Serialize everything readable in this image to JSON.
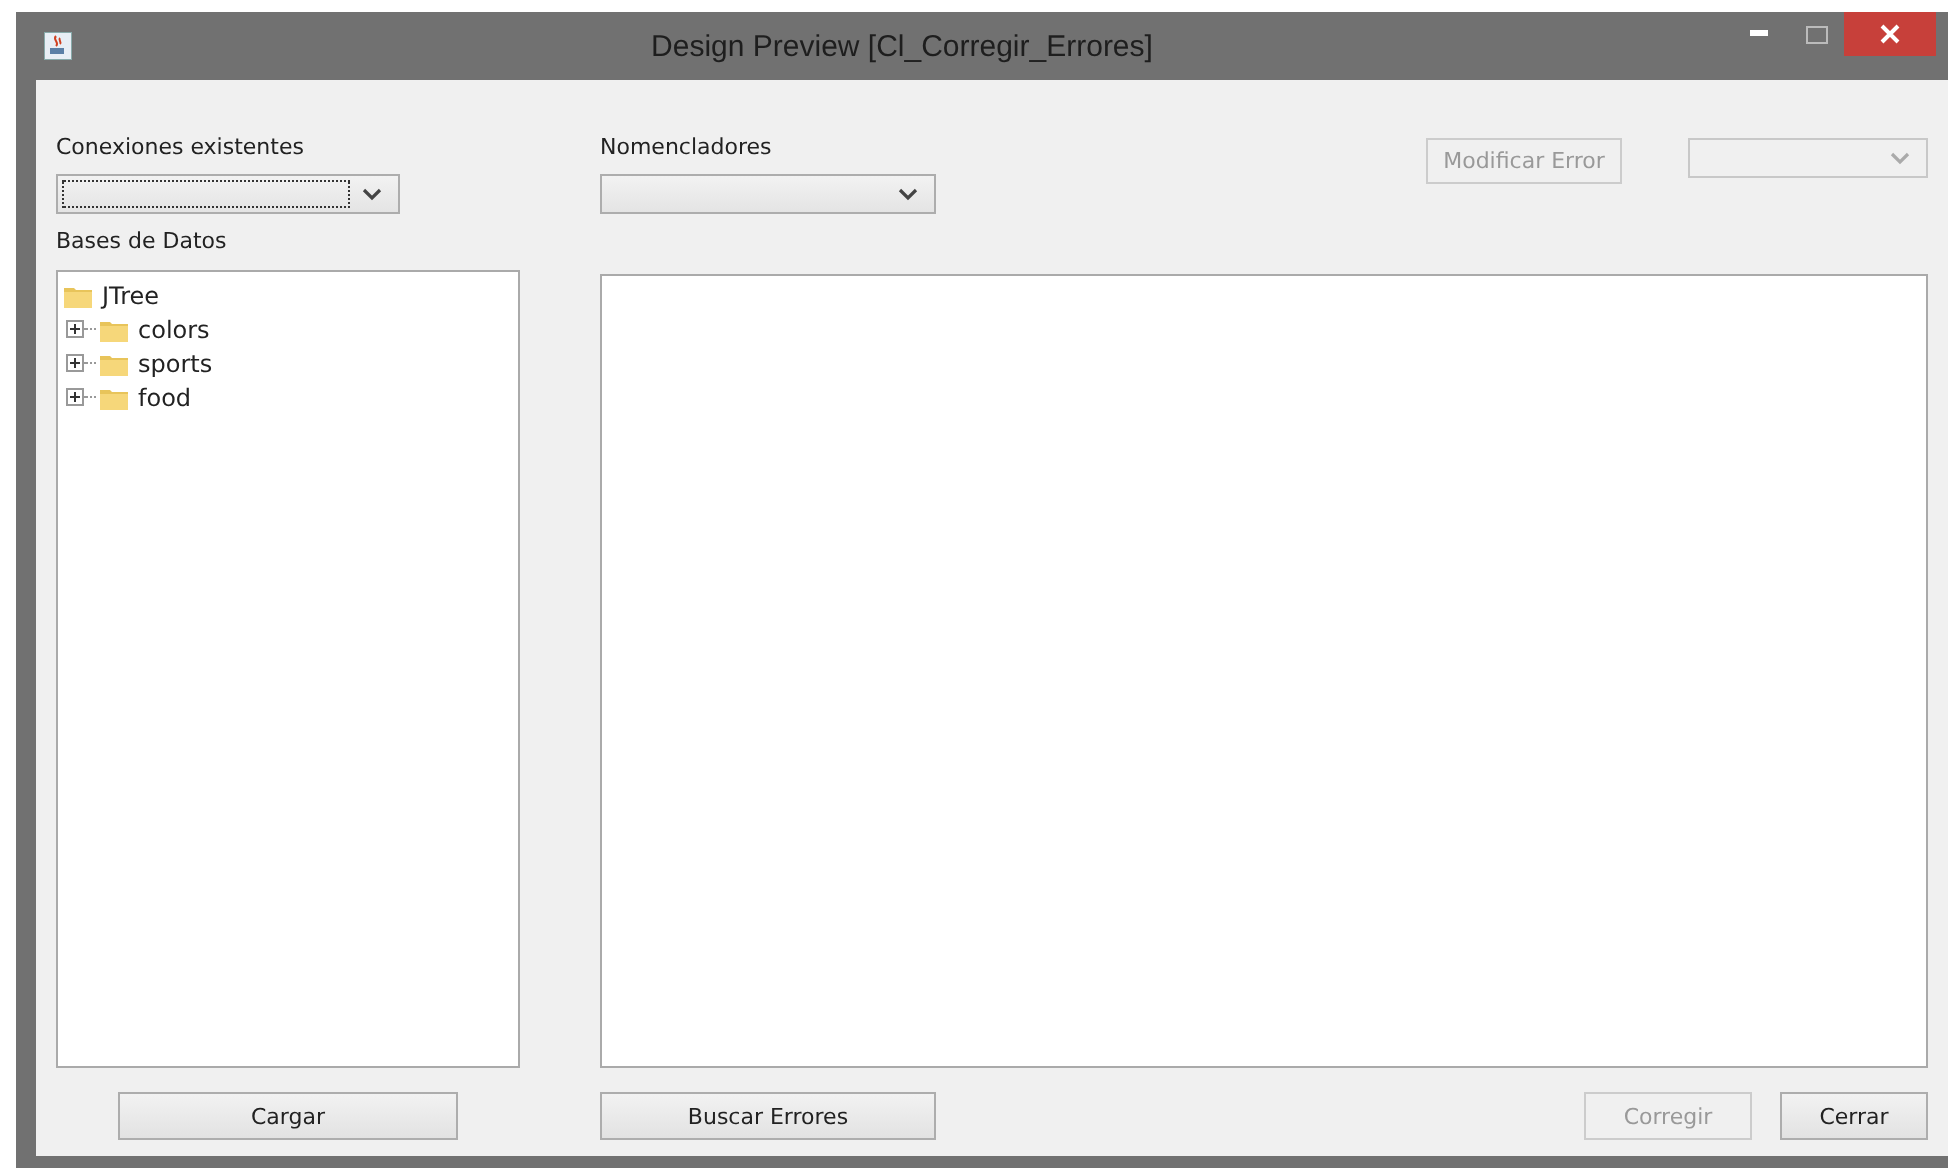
{
  "window": {
    "title": "Design Preview [Cl_Corregir_Errores]"
  },
  "left": {
    "connections_label": "Conexiones existentes",
    "connections_combo": {
      "disabled": false,
      "focused": true
    },
    "databases_label": "Bases de Datos",
    "tree": [
      {
        "label": "JTree",
        "expanded": true,
        "children": [
          {
            "label": "colors",
            "expanded": false
          },
          {
            "label": "sports",
            "expanded": false
          },
          {
            "label": "food",
            "expanded": false
          }
        ]
      }
    ],
    "load_button": {
      "label": "Cargar",
      "disabled": false
    }
  },
  "right": {
    "nomenclators_label": "Nomencladores",
    "nomenclators_combo": {
      "disabled": false,
      "focused": false
    },
    "modify_button": {
      "label": "Modificar Error",
      "disabled": true
    },
    "error_combo": {
      "disabled": true,
      "focused": false
    },
    "search_button": {
      "label": "Buscar Errores",
      "disabled": false
    },
    "correct_button": {
      "label": "Corregir",
      "disabled": true
    },
    "close_button": {
      "label": "Cerrar",
      "disabled": false
    }
  }
}
